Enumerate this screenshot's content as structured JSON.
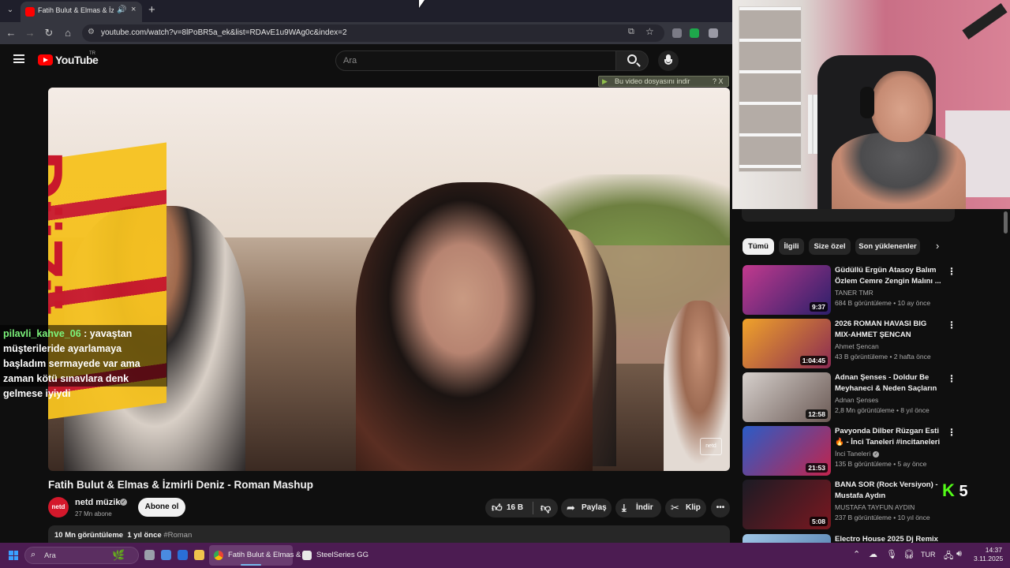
{
  "browser": {
    "tab": {
      "title": "Fatih Bulut & Elmas & İzmirli Deniz - Roman Mashup",
      "favicon": "youtube-favicon",
      "audio_icon": "speaker-icon",
      "close": "×"
    },
    "new_tab": "+",
    "tab_list": "⌄",
    "url": "youtube.com/watch?v=8lPoBR5a_ek&list=RDAvE1u9WAg0c&index=2"
  },
  "youtube": {
    "wordmark": "YouTube",
    "region": "TR",
    "search_placeholder": "Ara",
    "download_banner": "Bu video dosyasını indir",
    "download_banner_controls": "? X"
  },
  "video": {
    "title": "Fatih Bulut & Elmas & İzmirli Deniz - Roman Mashup",
    "graphic_text": "DüZü",
    "watermark": "netd",
    "chat": {
      "user": "pilavli_kahve_06",
      "message": ": yavaştan müşterileride ayarlamaya başladım sermayede var ama zaman kötü sınavlara denk gelmese iyiydi"
    },
    "channel": {
      "avatar_text": "netd",
      "name": "netd müzik",
      "subscribers": "27 Mn abone",
      "subscribe_label": "Abone ol"
    },
    "actions": {
      "likes": "16 B",
      "share": "Paylaş",
      "download": "İndir",
      "clip": "Klip",
      "more": "•••"
    },
    "description": {
      "views": "10 Mn görüntüleme",
      "age": "1 yıl önce",
      "hashtag": "#Roman"
    }
  },
  "sidebar": {
    "chips": [
      "Tümü",
      "İlgili",
      "Size özel",
      "Son yüklenenler"
    ],
    "recommendations": [
      {
        "title": "Güdüllü Ergün Atasoy Balım Özlem Cemre Zengin Malını ...",
        "channel": "TANER TMR",
        "verified": false,
        "meta": "684 B görüntüleme • 10 ay önce",
        "duration": "9:37",
        "thumb_colors": [
          "#c23a8e",
          "#2b1f6a"
        ]
      },
      {
        "title": "2026 ROMAN HAVASI BIG MIX-AHMET ŞENCAN",
        "channel": "Ahmet Şencan",
        "verified": false,
        "meta": "43 B görüntüleme • 2 hafta önce",
        "duration": "1:04:45",
        "thumb_colors": [
          "#f0a32a",
          "#8a2a52"
        ]
      },
      {
        "title": "Adnan Şenses - Doldur Be Meyhaneci & Neden Saçların ...",
        "channel": "Adnan Şenses",
        "verified": false,
        "meta": "2,8 Mn görüntüleme • 8 yıl önce",
        "duration": "12:58",
        "thumb_colors": [
          "#d6d0cc",
          "#6b5a55"
        ]
      },
      {
        "title": "Pavyonda Dilber Rüzgarı Esti 🔥 - İnci Taneleri #incitaneleri ...",
        "channel": "İnci Taneleri",
        "verified": true,
        "meta": "135 B görüntüleme • 5 ay önce",
        "duration": "21:53",
        "thumb_colors": [
          "#2a5cc7",
          "#c2244c"
        ]
      },
      {
        "title": "BANA SOR (Rock Versiyon) - Mustafa Aydın",
        "channel": "MUSTAFA TAYFUN AYDIN",
        "verified": false,
        "meta": "237 B görüntüleme • 10 yıl önce",
        "duration": "5:08",
        "thumb_colors": [
          "#1b1b24",
          "#7a1820"
        ]
      },
      {
        "title": "Electro House 2025 Dj Remix",
        "channel": "",
        "verified": false,
        "meta": "",
        "duration": "",
        "thumb_colors": [
          "#9fc6e6",
          "#4b78a8"
        ]
      }
    ]
  },
  "overlay": {
    "kick_icon": "K",
    "kick_count": "5"
  },
  "taskbar": {
    "search_placeholder": "Ara",
    "apps": [
      {
        "label": "Fatih Bulut & Elmas & İz",
        "icon": "chrome-icon"
      },
      {
        "label": "SteelSeries GG",
        "icon": "steelseries-icon"
      }
    ],
    "language": "TUR",
    "time": "14:37",
    "date": "3.11.2025"
  }
}
